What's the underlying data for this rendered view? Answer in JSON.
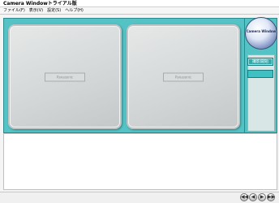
{
  "window": {
    "title": "Camera Windowトライアル版"
  },
  "menubar": {
    "items": [
      "ファイル(F)",
      "表示(V)",
      "設定(S)",
      "ヘルプ(H)"
    ]
  },
  "panels": [
    {
      "label": "Panasonic"
    },
    {
      "label": "Panasonic"
    }
  ],
  "sidebar": {
    "logo_text": "Camera Window",
    "button_1": "撮影開始",
    "button_2": ""
  },
  "footer": {
    "nav": [
      "◀◀",
      "◀",
      "▶",
      "▶▶"
    ]
  },
  "colors": {
    "workarea": "#53c3c6",
    "panel": "#d2d6d6"
  }
}
